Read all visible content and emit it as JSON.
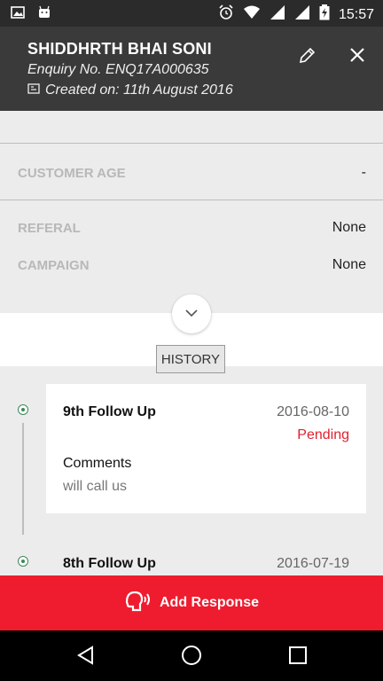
{
  "status_bar": {
    "time": "15:57"
  },
  "header": {
    "name": "SHIDDHRTH BHAI SONI",
    "enquiry": "Enquiry No. ENQ17A000635",
    "created": "Created on: 11th August 2016"
  },
  "details": [
    {
      "label": "CUSTOMER AGE",
      "value": "-"
    },
    {
      "label": "REFERAL",
      "value": "None"
    },
    {
      "label": "CAMPAIGN",
      "value": "None"
    }
  ],
  "history_label": "HISTORY",
  "history": [
    {
      "title": "9th Follow Up",
      "date": "2016-08-10",
      "status": "Pending",
      "comments_label": "Comments",
      "comments": "will call us"
    },
    {
      "title": "8th Follow Up",
      "date": "2016-07-19"
    }
  ],
  "add_response_label": "Add Response",
  "colors": {
    "accent": "#ee1c2e",
    "header": "#3a3a3a",
    "status": "#e0202f"
  }
}
